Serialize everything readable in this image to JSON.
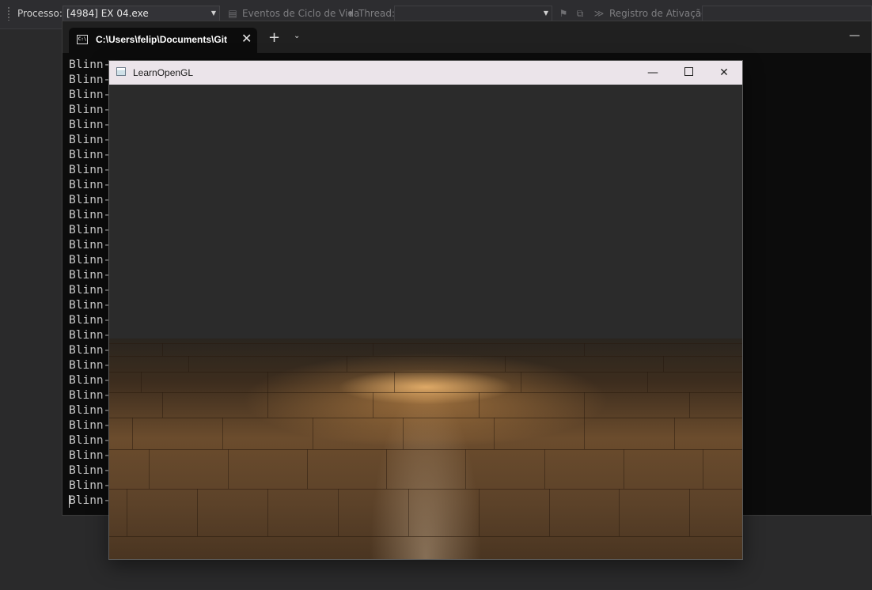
{
  "vs_toolbar": {
    "process_label": "Processo:",
    "process_value": "[4984] EX 04.exe",
    "lifecycle_label": "Eventos de Ciclo de Vida",
    "thread_label": "Thread:",
    "thread_value": "",
    "stack_label": "Registro de Ativação:",
    "stack_value": ""
  },
  "terminal": {
    "tab_title": "C:\\Users\\felip\\Documents\\Git",
    "lines": [
      "Blinn-",
      "Blinn-",
      "Blinn-",
      "Blinn-",
      "Blinn-",
      "Blinn-",
      "Blinn-",
      "Blinn-",
      "Blinn-",
      "Blinn-",
      "Blinn-",
      "Blinn-",
      "Blinn-",
      "Blinn-",
      "Blinn-",
      "Blinn-",
      "Blinn-",
      "Blinn-",
      "Blinn-",
      "Blinn-",
      "Blinn-",
      "Blinn-",
      "Blinn-",
      "Blinn-",
      "Blinn-",
      "Blinn-",
      "Blinn-",
      "Blinn-",
      "Blinn-",
      "Blinn-"
    ]
  },
  "gl_window": {
    "title": "LearnOpenGL"
  },
  "icons": {
    "terminal_tab": "console-icon",
    "new_tab": "plus-icon",
    "tab_dropdown": "chevron-down-icon",
    "close": "close-icon",
    "minimize": "minimize-icon",
    "maximize": "maximize-icon"
  },
  "colors": {
    "terminal_bg": "#0c0c0c",
    "gl_clear": "#2b2b2b",
    "floor_light": "#d8a060"
  }
}
